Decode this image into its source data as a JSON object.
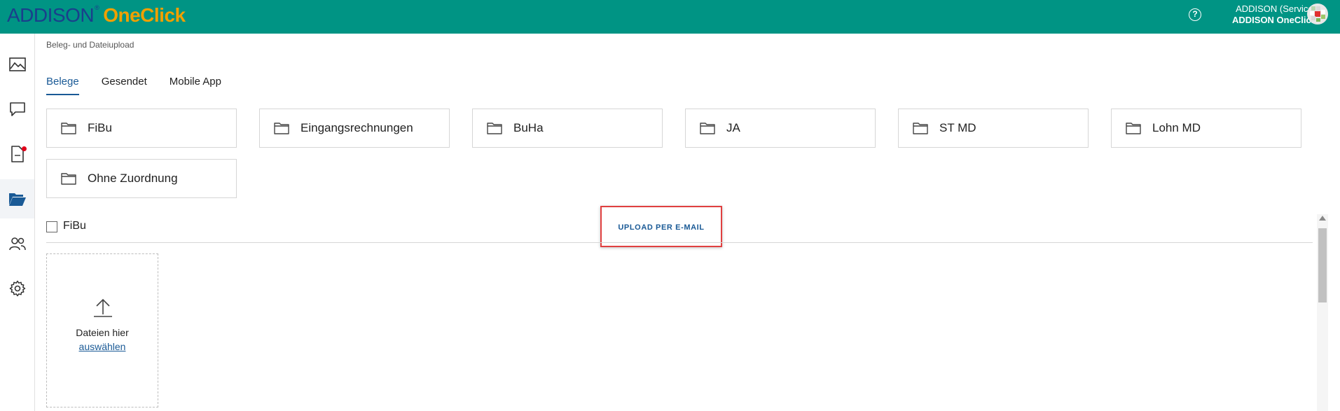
{
  "header": {
    "logo_brand": "ADDISON",
    "logo_reg": "®",
    "logo_product": "OneClick",
    "help_label": "?",
    "user_line1": "ADDISON (Service)",
    "user_line2": "ADDISON OneClick",
    "bg_color": "#009484"
  },
  "sidebar": {
    "items": [
      {
        "icon": "image-icon"
      },
      {
        "icon": "chat-icon"
      },
      {
        "icon": "document-icon",
        "badge": true
      },
      {
        "icon": "folder-open-icon",
        "active": true
      },
      {
        "icon": "users-icon"
      },
      {
        "icon": "gear-icon"
      }
    ]
  },
  "main": {
    "breadcrumb": "Beleg- und Dateiupload",
    "tabs": [
      {
        "label": "Belege",
        "active": true
      },
      {
        "label": "Gesendet"
      },
      {
        "label": "Mobile App"
      }
    ],
    "folders": [
      "FiBu",
      "Eingangsrechnungen",
      "BuHa",
      "JA",
      "ST MD",
      "Lohn MD",
      "Ohne Zuordnung"
    ],
    "section_label": "FiBu",
    "upload_mail_label": "UPLOAD PER E-MAIL",
    "dropzone": {
      "text": "Dateien hier",
      "link": "auswählen"
    }
  },
  "colors": {
    "accent": "#1a5a96",
    "highlight": "#e04040"
  }
}
